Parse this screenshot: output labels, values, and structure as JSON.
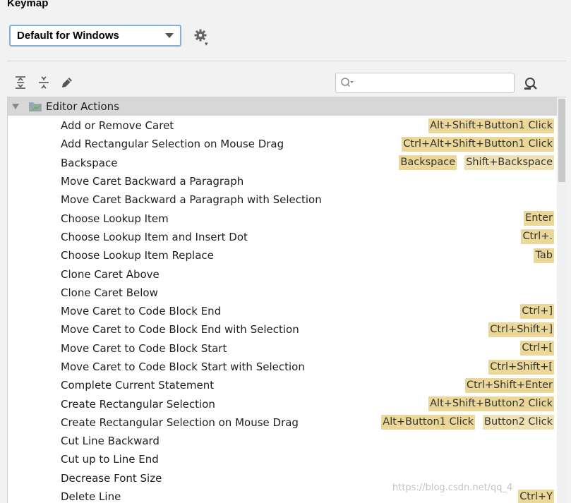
{
  "colors": {
    "accent_border": "#82aee3",
    "group_bg": "#d7d7d7",
    "shortcut_bg": "#f0e1b4",
    "shortcut_bg_strong": "#ebd899"
  },
  "header": {
    "title": "Keymap"
  },
  "scheme": {
    "selected": "Default for Windows"
  },
  "toolbar": {
    "icons": [
      "expand-all-icon",
      "collapse-all-icon",
      "edit-icon"
    ],
    "search_placeholder": "",
    "find_by_shortcut_icon": "find-by-shortcut-icon"
  },
  "tree": {
    "group": {
      "label": "Editor Actions"
    },
    "actions": [
      {
        "name": "Add or Remove Caret",
        "shortcuts": [
          "Alt+Shift+Button1 Click"
        ]
      },
      {
        "name": "Add Rectangular Selection on Mouse Drag",
        "shortcuts": [
          "Ctrl+Alt+Shift+Button1 Click"
        ]
      },
      {
        "name": "Backspace",
        "shortcuts": [
          "Backspace",
          "Shift+Backspace"
        ]
      },
      {
        "name": "Move Caret Backward a Paragraph",
        "shortcuts": []
      },
      {
        "name": "Move Caret Backward a Paragraph with Selection",
        "shortcuts": []
      },
      {
        "name": "Choose Lookup Item",
        "shortcuts": [
          "Enter"
        ]
      },
      {
        "name": "Choose Lookup Item and Insert Dot",
        "shortcuts": [
          "Ctrl+."
        ]
      },
      {
        "name": "Choose Lookup Item Replace",
        "shortcuts": [
          "Tab"
        ]
      },
      {
        "name": "Clone Caret Above",
        "shortcuts": []
      },
      {
        "name": "Clone Caret Below",
        "shortcuts": []
      },
      {
        "name": "Move Caret to Code Block End",
        "shortcuts": [
          "Ctrl+]"
        ]
      },
      {
        "name": "Move Caret to Code Block End with Selection",
        "shortcuts": [
          "Ctrl+Shift+]"
        ]
      },
      {
        "name": "Move Caret to Code Block Start",
        "shortcuts": [
          "Ctrl+["
        ]
      },
      {
        "name": "Move Caret to Code Block Start with Selection",
        "shortcuts": [
          "Ctrl+Shift+["
        ]
      },
      {
        "name": "Complete Current Statement",
        "shortcuts": [
          "Ctrl+Shift+Enter"
        ]
      },
      {
        "name": "Create Rectangular Selection",
        "shortcuts": [
          "Alt+Shift+Button2 Click"
        ]
      },
      {
        "name": "Create Rectangular Selection on Mouse Drag",
        "shortcuts": [
          "Alt+Button1 Click",
          "Button2 Click"
        ]
      },
      {
        "name": "Cut Line Backward",
        "shortcuts": []
      },
      {
        "name": "Cut up to Line End",
        "shortcuts": []
      },
      {
        "name": "Decrease Font Size",
        "shortcuts": []
      },
      {
        "name": "Delete Line",
        "shortcuts": [
          "Ctrl+Y"
        ]
      }
    ]
  },
  "watermark": "https://blog.csdn.net/qq_4"
}
